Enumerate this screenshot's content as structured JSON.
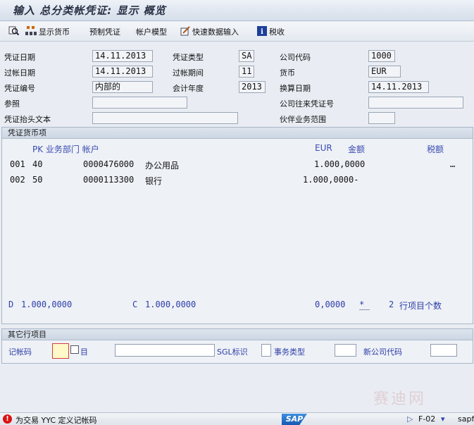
{
  "window": {
    "title": "输入 总分类帐凭证: 显示 概览"
  },
  "toolbar": {
    "show_currency": "显示货币",
    "park_doc": "预制凭证",
    "acct_model": "帐户模型",
    "fast_entry": "快速数据输入",
    "tax": "税收"
  },
  "header": {
    "doc_date_label": "凭证日期",
    "doc_date": "14.11.2013",
    "doc_type_label": "凭证类型",
    "doc_type": "SA",
    "company_label": "公司代码",
    "company": "1000",
    "post_date_label": "过帐日期",
    "post_date": "14.11.2013",
    "period_label": "过帐期间",
    "period": "11",
    "currency_label": "货币",
    "currency": "EUR",
    "doc_no_label": "凭证编号",
    "doc_no": "内部的",
    "fiscal_year_label": "会计年度",
    "fiscal_year": "2013",
    "trans_date_label": "换算日期",
    "trans_date": "14.11.2013",
    "reference_label": "参照",
    "reference": "",
    "intercompany_label": "公司往来凭证号",
    "intercompany": "",
    "header_text_label": "凭证抬头文本",
    "header_text": "",
    "partner_ba_label": "伙伴业务范围",
    "partner_ba": ""
  },
  "items_group": {
    "title": "凭证货币项",
    "col_pk_ba_acct": "PK 业务部门 帐户",
    "col_currency": "EUR",
    "col_amount": "金额",
    "col_tax": "税额",
    "rows": [
      {
        "no": "001",
        "pk": "40",
        "account": "0000476000",
        "name": "办公用品",
        "amount": "1.000,0000",
        "tax": "…"
      },
      {
        "no": "002",
        "pk": "50",
        "account": "0000113300",
        "name": "银行",
        "amount": "1.000,0000-",
        "tax": ""
      }
    ],
    "debit_label": "D",
    "debit_total": "1.000,0000",
    "credit_label": "C",
    "credit_total": "1.000,0000",
    "balance": "0,0000",
    "balance_flag": "*",
    "item_count": "2",
    "item_count_label": "行项目个数"
  },
  "other_group": {
    "title": "其它行项目",
    "post_key_label": "记帐码",
    "account_label": "目",
    "sgl_label": "SGL标识",
    "trans_type_label": "事务类型",
    "new_company_label": "新公司代码"
  },
  "status": {
    "message": "为交易 YYC 定义记帐码",
    "transaction": "F-02",
    "server": "sapfi",
    "logo": "SAP"
  },
  "watermark": "赛迪网"
}
